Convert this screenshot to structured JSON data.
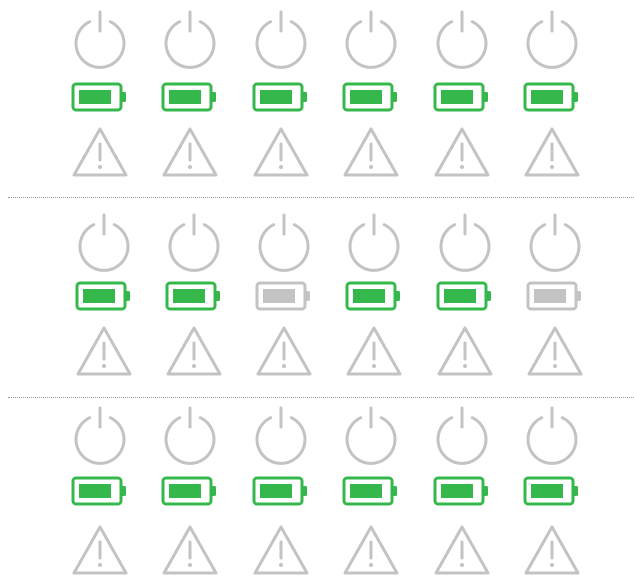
{
  "colors": {
    "accent": "#35b84b",
    "inactive": "#c3c3c3",
    "divider": "#9a9a9a",
    "background": "#ffffff"
  },
  "icon_names": {
    "power": "power-icon",
    "battery": "battery-icon",
    "warning": "warning-icon"
  },
  "panels": [
    {
      "name": "panel-1",
      "devices": [
        {
          "power_state": "off",
          "battery_state": "charged",
          "battery_level": 0.72,
          "warning_state": "inactive"
        },
        {
          "power_state": "off",
          "battery_state": "charged",
          "battery_level": 0.72,
          "warning_state": "inactive"
        },
        {
          "power_state": "off",
          "battery_state": "charged",
          "battery_level": 0.72,
          "warning_state": "inactive"
        },
        {
          "power_state": "off",
          "battery_state": "charged",
          "battery_level": 0.72,
          "warning_state": "inactive"
        },
        {
          "power_state": "off",
          "battery_state": "charged",
          "battery_level": 0.72,
          "warning_state": "inactive"
        },
        {
          "power_state": "off",
          "battery_state": "charged",
          "battery_level": 0.72,
          "warning_state": "inactive"
        }
      ]
    },
    {
      "name": "panel-2",
      "devices": [
        {
          "power_state": "off",
          "battery_state": "charged",
          "battery_level": 0.72,
          "warning_state": "inactive"
        },
        {
          "power_state": "off",
          "battery_state": "charged",
          "battery_level": 0.72,
          "warning_state": "inactive"
        },
        {
          "power_state": "off",
          "battery_state": "inactive",
          "battery_level": 0.72,
          "warning_state": "inactive"
        },
        {
          "power_state": "off",
          "battery_state": "charged",
          "battery_level": 0.72,
          "warning_state": "inactive"
        },
        {
          "power_state": "off",
          "battery_state": "charged",
          "battery_level": 0.72,
          "warning_state": "inactive"
        },
        {
          "power_state": "off",
          "battery_state": "inactive",
          "battery_level": 0.72,
          "warning_state": "inactive"
        }
      ]
    },
    {
      "name": "panel-3",
      "devices": [
        {
          "power_state": "off",
          "battery_state": "charged",
          "battery_level": 0.72,
          "warning_state": "inactive"
        },
        {
          "power_state": "off",
          "battery_state": "charged",
          "battery_level": 0.72,
          "warning_state": "inactive"
        },
        {
          "power_state": "off",
          "battery_state": "charged",
          "battery_level": 0.72,
          "warning_state": "inactive"
        },
        {
          "power_state": "off",
          "battery_state": "charged",
          "battery_level": 0.72,
          "warning_state": "inactive"
        },
        {
          "power_state": "off",
          "battery_state": "charged",
          "battery_level": 0.72,
          "warning_state": "inactive"
        },
        {
          "power_state": "off",
          "battery_state": "charged",
          "battery_level": 0.72,
          "warning_state": "inactive"
        }
      ]
    }
  ]
}
